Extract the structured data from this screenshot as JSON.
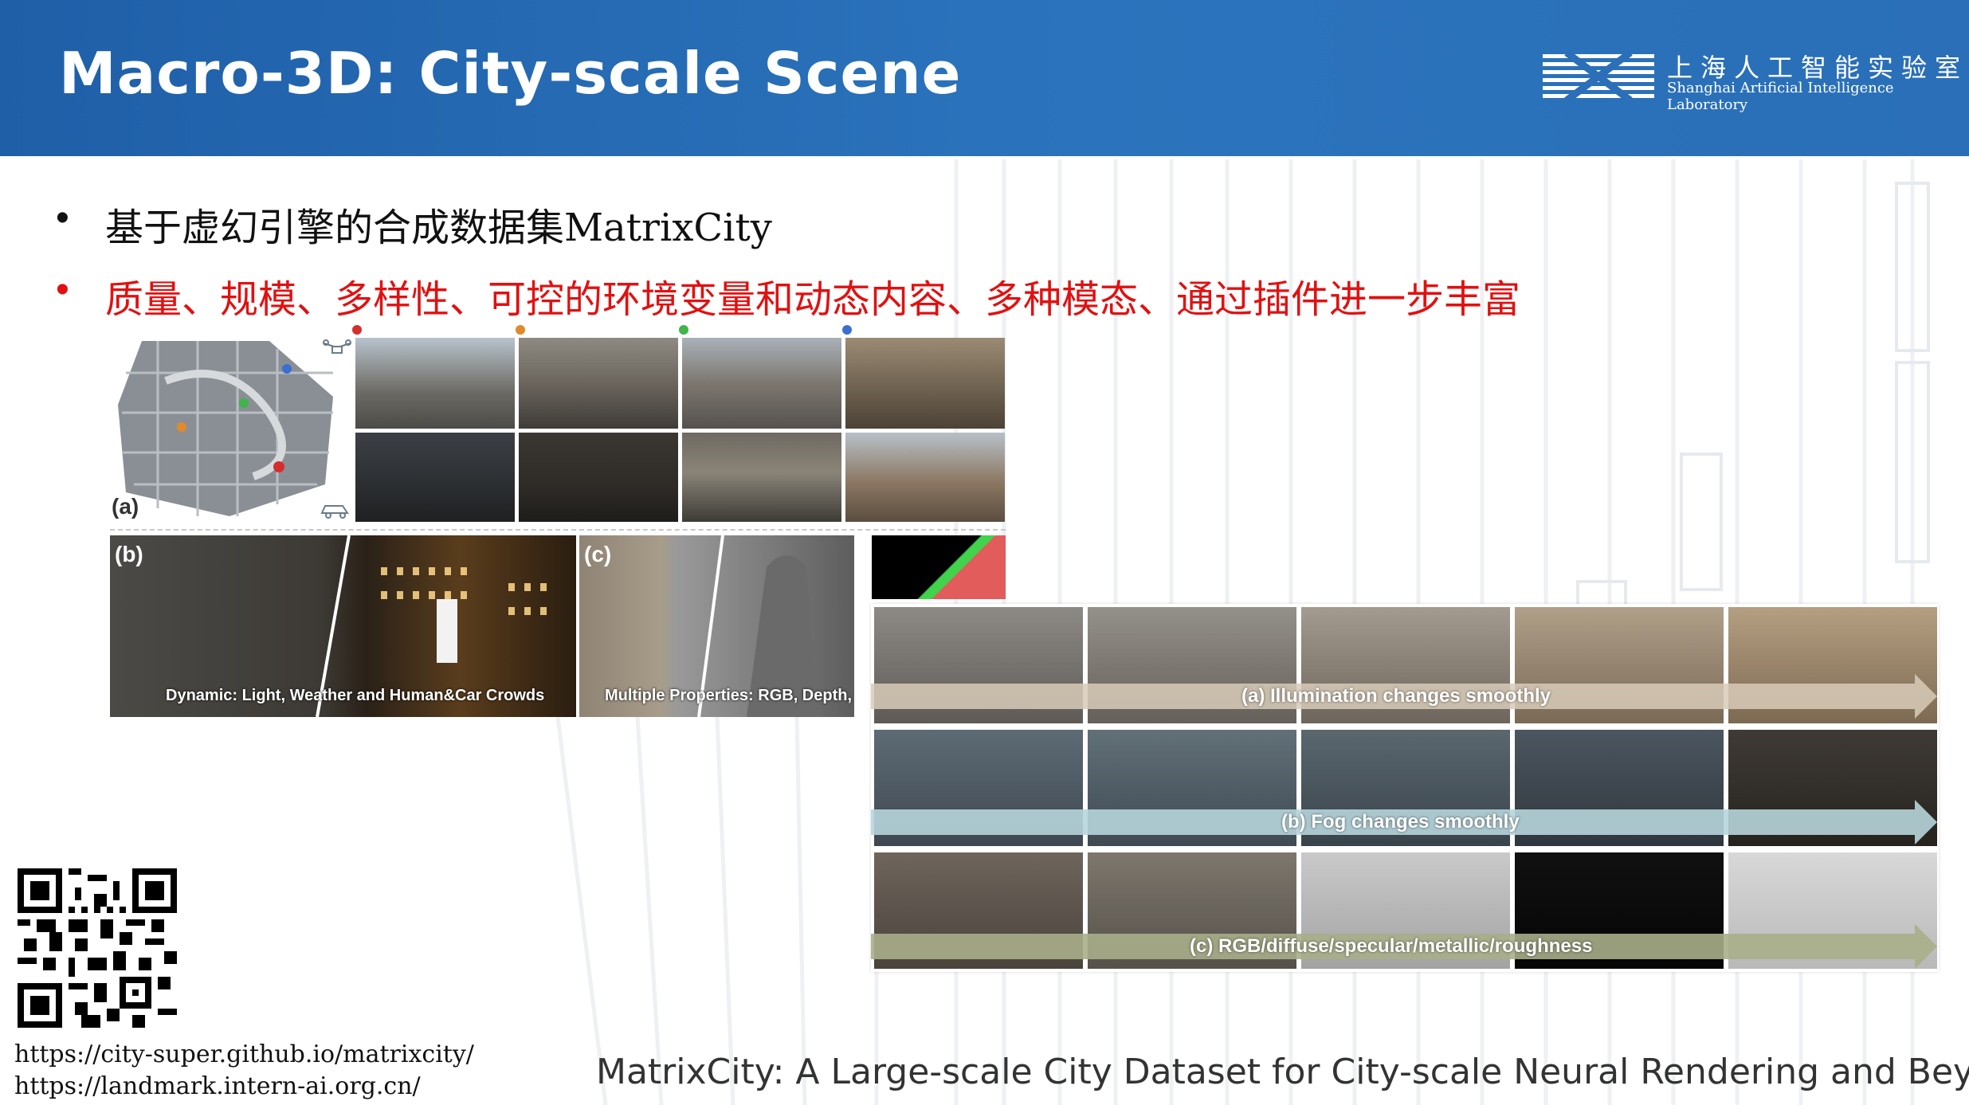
{
  "header": {
    "title": "Macro-3D: City-scale Scene",
    "logo_cn": "上海人工智能实验室",
    "logo_en": "Shanghai Artificial Intelligence Laboratory"
  },
  "bullets": [
    {
      "dot": "•",
      "text": "基于虚幻引擎的合成数据集MatrixCity",
      "color": "#111111"
    },
    {
      "dot": "•",
      "text": "质量、规模、多样性、可控的环境变量和动态内容、多种模态、通过插件进一步丰富",
      "color": "#e11111"
    }
  ],
  "figure": {
    "label_a": "(a)",
    "label_b": "(b)",
    "label_c": "(c)",
    "caption_b": "Dynamic: Light, Weather and Human&Car Crowds",
    "caption_c": "Multiple Properties: RGB, Depth, No"
  },
  "strips": {
    "a": "(a) Illumination changes smoothly",
    "b": "(b) Fog changes smoothly",
    "c": "(c) RGB/diffuse/specular/metallic/roughness"
  },
  "links": {
    "url1": "https://city-super.github.io/matrixcity/",
    "url2": "https://landmark.intern-ai.org.cn/"
  },
  "reference": "MatrixCity: A Large-scale City Dataset for City-scale Neural Rendering and Beyond",
  "colors": {
    "header": "#2466b0",
    "highlight": "#e11111"
  }
}
